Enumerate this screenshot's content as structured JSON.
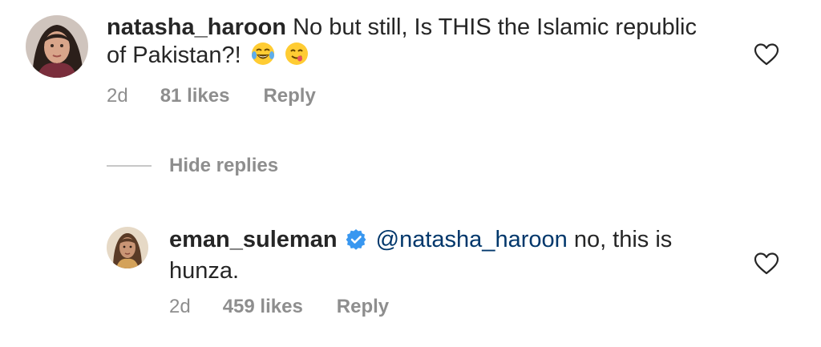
{
  "comments": [
    {
      "username": "natasha_haroon",
      "text": "No but still, Is THIS the Islamic republic of Pakistan?!",
      "emojis": [
        "face-with-tears-of-joy",
        "face-savoring-food"
      ],
      "time": "2d",
      "likes": "81 likes",
      "reply_label": "Reply"
    },
    {
      "username": "eman_suleman",
      "verified": true,
      "mention": "@natasha_haroon",
      "text": "no, this is hunza.",
      "time": "2d",
      "likes": "459 likes",
      "reply_label": "Reply"
    }
  ],
  "hide_replies_label": "Hide replies",
  "icons": {
    "like": "heart-icon",
    "verified": "verified-badge-icon"
  },
  "colors": {
    "text": "#262626",
    "secondary": "#8e8e8e",
    "mention": "#00376b",
    "verified": "#3897f0"
  }
}
